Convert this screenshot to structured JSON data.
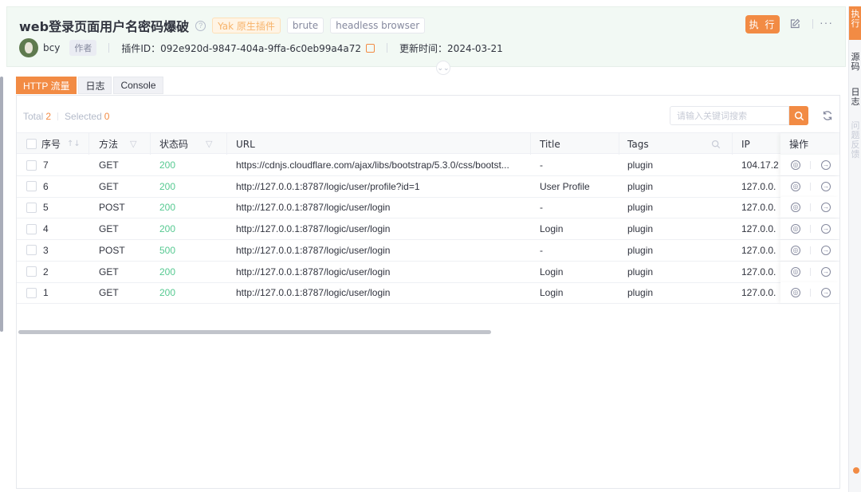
{
  "header": {
    "title": "web登录页面用户名密码爆破",
    "help_icon": "question-circle-icon",
    "tags": [
      "Yak 原生插件",
      "brute",
      "headless browser"
    ],
    "author": {
      "name": "bcy",
      "role_tag": "作者"
    },
    "plugin_id": "插件ID：092e920d-9847-404a-9ffa-6c0eb99a4a72",
    "updated": "更新时间：2024-03-21",
    "exec_button": "执 行",
    "accent_color": "#f28b44"
  },
  "side_tabs": {
    "active": "执行",
    "items": [
      "源码",
      "日志"
    ],
    "disabled": "问题反馈"
  },
  "output_tabs": [
    "HTTP 流量",
    "日志",
    "Console"
  ],
  "toolbar": {
    "total_label": "Total",
    "total_value": "2",
    "selected_label": "Selected",
    "selected_value": "0",
    "search_placeholder": "请输入关键词搜索"
  },
  "table": {
    "columns": [
      "序号",
      "方法",
      "状态码",
      "URL",
      "Title",
      "Tags",
      "IP",
      "操作"
    ],
    "rows": [
      {
        "id": "7",
        "method": "GET",
        "status": "200",
        "url": "https://cdnjs.cloudflare.com/ajax/libs/bootstrap/5.3.0/css/bootst...",
        "title": "-",
        "tags": "plugin",
        "ip": "104.17.2"
      },
      {
        "id": "6",
        "method": "GET",
        "status": "200",
        "url": "http://127.0.0.1:8787/logic/user/profile?id=1",
        "title": "User Profile",
        "tags": "plugin",
        "ip": "127.0.0."
      },
      {
        "id": "5",
        "method": "POST",
        "status": "200",
        "url": "http://127.0.0.1:8787/logic/user/login",
        "title": "-",
        "tags": "plugin",
        "ip": "127.0.0."
      },
      {
        "id": "4",
        "method": "GET",
        "status": "200",
        "url": "http://127.0.0.1:8787/logic/user/login",
        "title": "Login",
        "tags": "plugin",
        "ip": "127.0.0."
      },
      {
        "id": "3",
        "method": "POST",
        "status": "500",
        "url": "http://127.0.0.1:8787/logic/user/login",
        "title": "-",
        "tags": "plugin",
        "ip": "127.0.0."
      },
      {
        "id": "2",
        "method": "GET",
        "status": "200",
        "url": "http://127.0.0.1:8787/logic/user/login",
        "title": "Login",
        "tags": "plugin",
        "ip": "127.0.0."
      },
      {
        "id": "1",
        "method": "GET",
        "status": "200",
        "url": "http://127.0.0.1:8787/logic/user/login",
        "title": "Login",
        "tags": "plugin",
        "ip": "127.0.0."
      }
    ],
    "status_color": "#56c991"
  }
}
